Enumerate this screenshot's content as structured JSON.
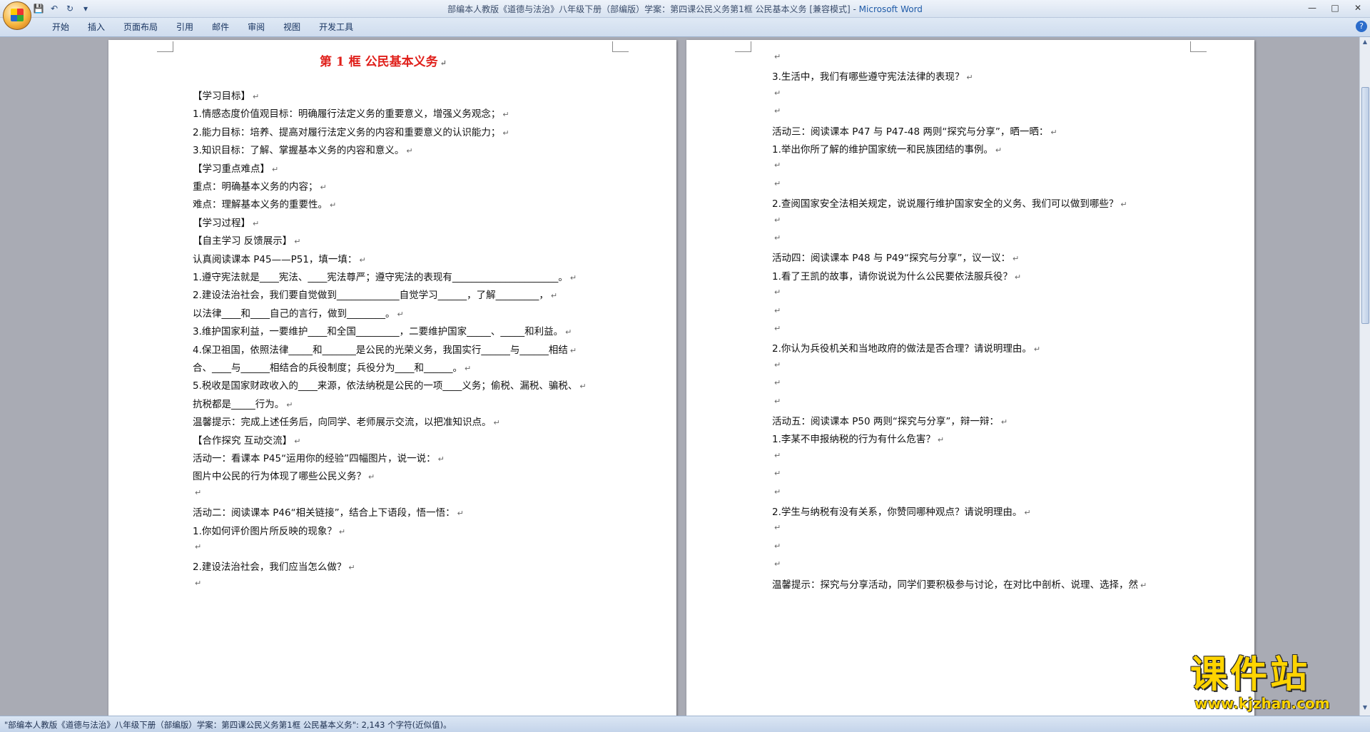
{
  "window": {
    "title": "部编本人教版《道德与法治》八年级下册（部编版）学案：第四课公民义务第1框  公民基本义务 [兼容模式] - ",
    "app_name": "Microsoft Word"
  },
  "ribbon": {
    "tabs": [
      "开始",
      "插入",
      "页面布局",
      "引用",
      "邮件",
      "审阅",
      "视图",
      "开发工具"
    ]
  },
  "page1": {
    "heading": "第 1 框    公民基本义务",
    "lines": [
      "【学习目标】",
      "1.情感态度价值观目标：明确履行法定义务的重要意义，增强义务观念；",
      "2.能力目标：培养、提高对履行法定义务的内容和重要意义的认识能力；",
      "3.知识目标：了解、掌握基本义务的内容和意义。",
      "【学习重点难点】",
      "重点：明确基本义务的内容；",
      "难点：理解基本义务的重要性。",
      "【学习过程】",
      "【自主学习   反馈展示】",
      "认真阅读课本 P45——P51，填一填：",
      "1.遵守宪法就是____宪法、____宪法尊严；遵守宪法的表现有______________________。",
      "2.建设法治社会，我们要自觉做到_____________自觉学习______，了解_________，",
      "以法律____和____自己的言行，做到________。",
      "3.维护国家利益，一要维护____和全国_________，二要维护国家_____、_____和利益。",
      "4.保卫祖国，依照法律_____和_______是公民的光荣义务，我国实行______与______相结",
      "合、____与______相结合的兵役制度；兵役分为____和______。",
      "5.税收是国家财政收入的____来源，依法纳税是公民的一项____义务；偷税、漏税、骗税、",
      "抗税都是_____行为。",
      "    温馨提示：完成上述任务后，向同学、老师展示交流，以把准知识点。",
      "【合作探究   互动交流】",
      "活动一：看课本 P45“运用你的经验”四幅图片，说一说：",
      "图片中公民的行为体现了哪些公民义务？",
      "",
      "活动二：阅读课本 P46“相关链接”，结合上下语段，悟一悟：",
      "1.你如何评价图片所反映的现象？",
      "",
      "2.建设法治社会，我们应当怎么做？",
      ""
    ]
  },
  "page2": {
    "lines": [
      "",
      "3.生活中，我们有哪些遵守宪法法律的表现？",
      "",
      "",
      "活动三：阅读课本 P47 与 P47-48 两则“探究与分享”，晒一晒：",
      "1.举出你所了解的维护国家统一和民族团结的事例。",
      "",
      "",
      "2.查阅国家安全法相关规定，说说履行维护国家安全的义务、我们可以做到哪些？",
      "",
      "",
      "活动四：阅读课本 P48 与 P49“探究与分享”，议一议：",
      "1.看了王凯的故事，请你说说为什么公民要依法服兵役？",
      "",
      "",
      "",
      "2.你认为兵役机关和当地政府的做法是否合理？请说明理由。",
      "",
      "",
      "",
      "活动五：阅读课本 P50 两则“探究与分享”，辩一辩：",
      "1.李某不申报纳税的行为有什么危害？",
      "",
      "",
      "",
      "2.学生与纳税有没有关系，你赞同哪种观点？请说明理由。",
      "    ",
      "    ",
      "    ",
      "    温馨提示：探究与分享活动，同学们要积极参与讨论，在对比中剖析、说理、选择，然"
    ]
  },
  "status": {
    "text": "\"部编本人教版《道德与法治》八年级下册（部编版）学案：第四课公民义务第1框  公民基本义务\": 2,143 个字符(近似值)。"
  },
  "watermark": {
    "text": "课件站",
    "url": "www.kjzhan.com"
  },
  "colors": {
    "heading": "#e0201b",
    "watermark": "#ffd400",
    "workspace": "#a9abb4"
  }
}
